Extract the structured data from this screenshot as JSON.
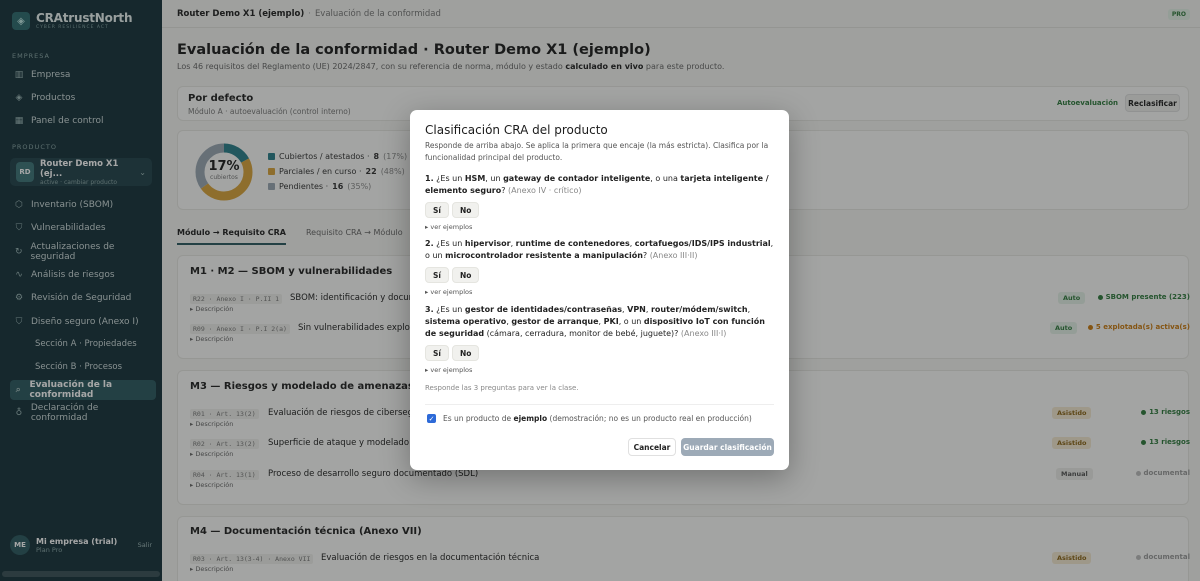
{
  "brand": {
    "name": "CRAtrustNorth",
    "tagline": "CYBER RESILIENCE ACT"
  },
  "sidebar": {
    "empresa_label": "EMPRESA",
    "empresa_items": [
      {
        "label": "Empresa",
        "icon": "building-icon"
      },
      {
        "label": "Productos",
        "icon": "layers-icon"
      },
      {
        "label": "Panel de control",
        "icon": "grid-icon"
      }
    ],
    "producto_label": "PRODUCTO",
    "product": {
      "badge": "RD",
      "name": "Router Demo X1 (ej...",
      "sub": "active · cambiar producto"
    },
    "product_items": [
      {
        "label": "Inventario (SBOM)",
        "icon": "package-icon"
      },
      {
        "label": "Vulnerabilidades",
        "icon": "shield-icon"
      },
      {
        "label": "Actualizaciones de seguridad",
        "icon": "refresh-icon"
      },
      {
        "label": "Análisis de riesgos",
        "icon": "activity-icon"
      },
      {
        "label": "Revisión de Seguridad",
        "icon": "gear-icon"
      },
      {
        "label": "Diseño seguro (Anexo I)",
        "icon": "shield-check-icon"
      },
      {
        "label": "Sección A · Propiedades",
        "icon": ""
      },
      {
        "label": "Sección B · Procesos",
        "icon": ""
      },
      {
        "label": "Evaluación de la conformidad",
        "icon": "search-icon"
      },
      {
        "label": "Declaración de conformidad",
        "icon": "award-icon"
      }
    ],
    "user": {
      "badge": "ME",
      "name": "Mi empresa (trial)",
      "plan": "Plan Pro",
      "logout": "Salir"
    }
  },
  "topbar": {
    "product": "Router Demo X1 (ejemplo)",
    "separator": "·",
    "page": "Evaluación de la conformidad",
    "plan_badge": "PRO"
  },
  "header": {
    "title": "Evaluación de la conformidad · Router Demo X1 (ejemplo)",
    "desc_a": "Los 46 requisitos del Reglamento (UE) 2024/2847, con su referencia de norma, módulo y estado ",
    "desc_b": "calculado en vivo",
    "desc_c": " para este producto."
  },
  "classification": {
    "title": "Por defecto",
    "sub": "Módulo A · autoevaluación (control interno)",
    "link": "Autoevaluación",
    "button": "Reclasificar"
  },
  "summary": {
    "percent": "17%",
    "percent_label": "cubiertos",
    "legend": [
      {
        "label": "Cubiertos / atestados ·",
        "value": "8",
        "pct": "(17%)",
        "color": "#2a7f8a"
      },
      {
        "label": "Parciales / en curso ·",
        "value": "22",
        "pct": "(48%)",
        "color": "#d9a43b"
      },
      {
        "label": "Pendientes ·",
        "value": "16",
        "pct": "(35%)",
        "color": "#9aa6b2"
      }
    ],
    "fractions": [
      0.17,
      0.48,
      0.35
    ]
  },
  "tabs": [
    "Módulo → Requisito CRA",
    "Requisito CRA → Módulo"
  ],
  "sections": [
    {
      "title": "M1 · M2 — SBOM y vulnerabilidades",
      "rows": [
        {
          "code": "R22 · Anexo I · P.II 1",
          "text": "SBOM: identificación y documen",
          "desc": "▸ Descripción",
          "tag": "Auto",
          "status": "SBOM presente (223)",
          "status_color": "#2f7a3d"
        },
        {
          "code": "R09 · Anexo I · P.I 2(a)",
          "text": "Sin vulnerabilidades explotable",
          "desc": "▸ Descripción",
          "tag": "Auto",
          "status": "5 explotada(s) activa(s)",
          "status_color": "#c97a10"
        }
      ]
    },
    {
      "title": "M3 — Riesgos y modelado de amenazas",
      "rows": [
        {
          "code": "R01 · Art. 13(2)",
          "text": "Evaluación de riesgos de cibersegurid",
          "desc": "▸ Descripción",
          "tag": "Asistido",
          "status": "13 riesgos",
          "status_color": "#2f7a3d"
        },
        {
          "code": "R02 · Art. 13(2)",
          "text": "Superficie de ataque y modelado de a",
          "desc": "▸ Descripción",
          "tag": "Asistido",
          "status": "13 riesgos",
          "status_color": "#2f7a3d"
        },
        {
          "code": "R04 · Art. 13(1)",
          "text": "Proceso de desarrollo seguro documentado (SDL)",
          "desc": "▸ Descripción",
          "tag": "Manual",
          "status": "documental",
          "status_color": "#aaaaaa"
        }
      ]
    },
    {
      "title": "M4 — Documentación técnica (Anexo VII)",
      "rows": [
        {
          "code": "R03 · Art. 13(3-4) · Anexo VII",
          "text": "Evaluación de riesgos en la documentación técnica",
          "desc": "▸ Descripción",
          "tag": "Asistido",
          "status": "documental",
          "status_color": "#aaaaaa"
        }
      ]
    }
  ],
  "modal": {
    "title": "Clasificación CRA del producto",
    "intro": "Responde de arriba abajo. Se aplica la primera que encaje (la más estricta). Clasifica por la funcionalidad principal del producto.",
    "q1": {
      "n": "1.",
      "t1": " ¿Es un ",
      "b1": "HSM",
      "t2": ", un ",
      "b2": "gateway de contador inteligente",
      "t3": ", o una ",
      "b3": "tarjeta inteligente / elemento seguro",
      "t4": "? ",
      "m": "(Anexo IV · crítico)"
    },
    "q2": {
      "n": "2.",
      "t1": " ¿Es un ",
      "b1": "hipervisor",
      "t2": ", ",
      "b2": "runtime de contenedores",
      "t3": ", ",
      "b3": "cortafuegos/IDS/IPS industrial",
      "t4": ", o un ",
      "b4": "microcontrolador resistente a manipulación",
      "t5": "? ",
      "m": "(Anexo III·II)"
    },
    "q3": {
      "n": "3.",
      "t1": " ¿Es un ",
      "b1": "gestor de identidades/contraseñas",
      "t2": ", ",
      "b2": "VPN",
      "t3": ", ",
      "b3": "router/módem/switch",
      "t4": ", ",
      "b4": "sistema operativo",
      "t5": ", ",
      "b5": "gestor de arranque",
      "t6": ", ",
      "b6": "PKI",
      "t7": ", o un ",
      "b7": "dispositivo IoT con función de seguridad",
      "t8": " (cámara, cerradura, monitor de bebé, juguete)? ",
      "m": "(Anexo III·I)"
    },
    "yes": "Sí",
    "no": "No",
    "examples": "ver ejemplos",
    "hint": "Responde las 3 preguntas para ver la clase.",
    "check_a": "Es un producto de ",
    "check_b": "ejemplo",
    "check_c": " (demostración; no es un producto real en producción)",
    "check_value": true,
    "cancel": "Cancelar",
    "save": "Guardar clasificación"
  }
}
